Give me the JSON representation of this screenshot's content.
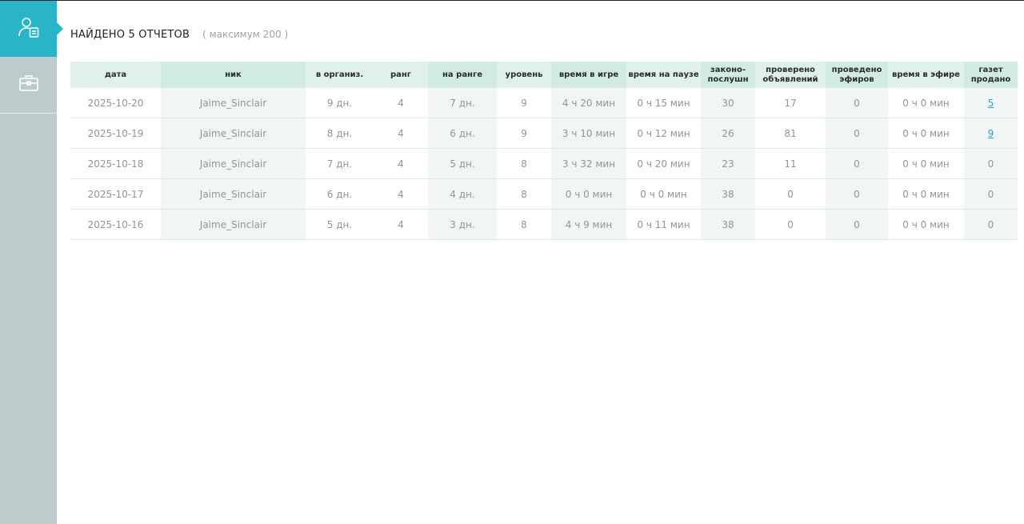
{
  "sidebar": {
    "items": [
      {
        "icon": "user-report-icon",
        "active": true
      },
      {
        "icon": "briefcase-icon",
        "active": false
      }
    ]
  },
  "header": {
    "title": "НАЙДЕНО 5 ОТЧЕТОВ",
    "subtitle": "( максимум 200 )"
  },
  "table": {
    "columns": [
      "дата",
      "ник",
      "в организ.",
      "ранг",
      "на ранге",
      "уровень",
      "время в игре",
      "время на паузе",
      "законо-\nпослушн",
      "проверено\nобъявлений",
      "проведено\nэфиров",
      "время в эфире",
      "газет\nпродано"
    ],
    "rows": [
      [
        "2025-10-20",
        "Jaime_Sinclair",
        "9 дн.",
        "4",
        "7 дн.",
        "9",
        "4 ч 20 мин",
        "0 ч 15 мин",
        "30",
        "17",
        "0",
        "0 ч 0 мин",
        "5"
      ],
      [
        "2025-10-19",
        "Jaime_Sinclair",
        "8 дн.",
        "4",
        "6 дн.",
        "9",
        "3 ч 10 мин",
        "0 ч 12 мин",
        "26",
        "81",
        "0",
        "0 ч 0 мин",
        "9"
      ],
      [
        "2025-10-18",
        "Jaime_Sinclair",
        "7 дн.",
        "4",
        "5 дн.",
        "8",
        "3 ч 32 мин",
        "0 ч 20 мин",
        "23",
        "11",
        "0",
        "0 ч 0 мин",
        "0"
      ],
      [
        "2025-10-17",
        "Jaime_Sinclair",
        "6 дн.",
        "4",
        "4 дн.",
        "8",
        "0 ч 0 мин",
        "0 ч 0 мин",
        "38",
        "0",
        "0",
        "0 ч 0 мин",
        "0"
      ],
      [
        "2025-10-16",
        "Jaime_Sinclair",
        "5 дн.",
        "4",
        "3 дн.",
        "8",
        "4 ч 9 мин",
        "0 ч 11 мин",
        "38",
        "0",
        "0",
        "0 ч 0 мин",
        "0"
      ]
    ],
    "linked_column": 12
  },
  "colors": {
    "accent": "#29b5c9",
    "sidebar": "#bccccc",
    "header_bg": "#e0f1e9",
    "link": "#2aa7cf"
  }
}
